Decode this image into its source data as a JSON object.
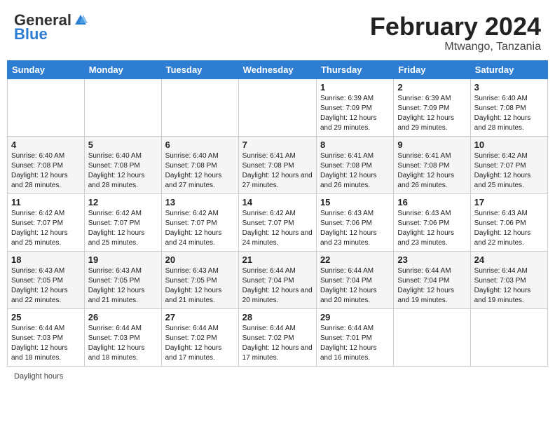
{
  "header": {
    "logo_general": "General",
    "logo_blue": "Blue",
    "month_year": "February 2024",
    "location": "Mtwango, Tanzania"
  },
  "footer": {
    "daylight_label": "Daylight hours"
  },
  "days_of_week": [
    "Sunday",
    "Monday",
    "Tuesday",
    "Wednesday",
    "Thursday",
    "Friday",
    "Saturday"
  ],
  "weeks": [
    [
      {
        "day": "",
        "info": ""
      },
      {
        "day": "",
        "info": ""
      },
      {
        "day": "",
        "info": ""
      },
      {
        "day": "",
        "info": ""
      },
      {
        "day": "1",
        "info": "Sunrise: 6:39 AM\nSunset: 7:09 PM\nDaylight: 12 hours and 29 minutes."
      },
      {
        "day": "2",
        "info": "Sunrise: 6:39 AM\nSunset: 7:09 PM\nDaylight: 12 hours and 29 minutes."
      },
      {
        "day": "3",
        "info": "Sunrise: 6:40 AM\nSunset: 7:08 PM\nDaylight: 12 hours and 28 minutes."
      }
    ],
    [
      {
        "day": "4",
        "info": "Sunrise: 6:40 AM\nSunset: 7:08 PM\nDaylight: 12 hours and 28 minutes."
      },
      {
        "day": "5",
        "info": "Sunrise: 6:40 AM\nSunset: 7:08 PM\nDaylight: 12 hours and 28 minutes."
      },
      {
        "day": "6",
        "info": "Sunrise: 6:40 AM\nSunset: 7:08 PM\nDaylight: 12 hours and 27 minutes."
      },
      {
        "day": "7",
        "info": "Sunrise: 6:41 AM\nSunset: 7:08 PM\nDaylight: 12 hours and 27 minutes."
      },
      {
        "day": "8",
        "info": "Sunrise: 6:41 AM\nSunset: 7:08 PM\nDaylight: 12 hours and 26 minutes."
      },
      {
        "day": "9",
        "info": "Sunrise: 6:41 AM\nSunset: 7:08 PM\nDaylight: 12 hours and 26 minutes."
      },
      {
        "day": "10",
        "info": "Sunrise: 6:42 AM\nSunset: 7:07 PM\nDaylight: 12 hours and 25 minutes."
      }
    ],
    [
      {
        "day": "11",
        "info": "Sunrise: 6:42 AM\nSunset: 7:07 PM\nDaylight: 12 hours and 25 minutes."
      },
      {
        "day": "12",
        "info": "Sunrise: 6:42 AM\nSunset: 7:07 PM\nDaylight: 12 hours and 25 minutes."
      },
      {
        "day": "13",
        "info": "Sunrise: 6:42 AM\nSunset: 7:07 PM\nDaylight: 12 hours and 24 minutes."
      },
      {
        "day": "14",
        "info": "Sunrise: 6:42 AM\nSunset: 7:07 PM\nDaylight: 12 hours and 24 minutes."
      },
      {
        "day": "15",
        "info": "Sunrise: 6:43 AM\nSunset: 7:06 PM\nDaylight: 12 hours and 23 minutes."
      },
      {
        "day": "16",
        "info": "Sunrise: 6:43 AM\nSunset: 7:06 PM\nDaylight: 12 hours and 23 minutes."
      },
      {
        "day": "17",
        "info": "Sunrise: 6:43 AM\nSunset: 7:06 PM\nDaylight: 12 hours and 22 minutes."
      }
    ],
    [
      {
        "day": "18",
        "info": "Sunrise: 6:43 AM\nSunset: 7:05 PM\nDaylight: 12 hours and 22 minutes."
      },
      {
        "day": "19",
        "info": "Sunrise: 6:43 AM\nSunset: 7:05 PM\nDaylight: 12 hours and 21 minutes."
      },
      {
        "day": "20",
        "info": "Sunrise: 6:43 AM\nSunset: 7:05 PM\nDaylight: 12 hours and 21 minutes."
      },
      {
        "day": "21",
        "info": "Sunrise: 6:44 AM\nSunset: 7:04 PM\nDaylight: 12 hours and 20 minutes."
      },
      {
        "day": "22",
        "info": "Sunrise: 6:44 AM\nSunset: 7:04 PM\nDaylight: 12 hours and 20 minutes."
      },
      {
        "day": "23",
        "info": "Sunrise: 6:44 AM\nSunset: 7:04 PM\nDaylight: 12 hours and 19 minutes."
      },
      {
        "day": "24",
        "info": "Sunrise: 6:44 AM\nSunset: 7:03 PM\nDaylight: 12 hours and 19 minutes."
      }
    ],
    [
      {
        "day": "25",
        "info": "Sunrise: 6:44 AM\nSunset: 7:03 PM\nDaylight: 12 hours and 18 minutes."
      },
      {
        "day": "26",
        "info": "Sunrise: 6:44 AM\nSunset: 7:03 PM\nDaylight: 12 hours and 18 minutes."
      },
      {
        "day": "27",
        "info": "Sunrise: 6:44 AM\nSunset: 7:02 PM\nDaylight: 12 hours and 17 minutes."
      },
      {
        "day": "28",
        "info": "Sunrise: 6:44 AM\nSunset: 7:02 PM\nDaylight: 12 hours and 17 minutes."
      },
      {
        "day": "29",
        "info": "Sunrise: 6:44 AM\nSunset: 7:01 PM\nDaylight: 12 hours and 16 minutes."
      },
      {
        "day": "",
        "info": ""
      },
      {
        "day": "",
        "info": ""
      }
    ]
  ]
}
